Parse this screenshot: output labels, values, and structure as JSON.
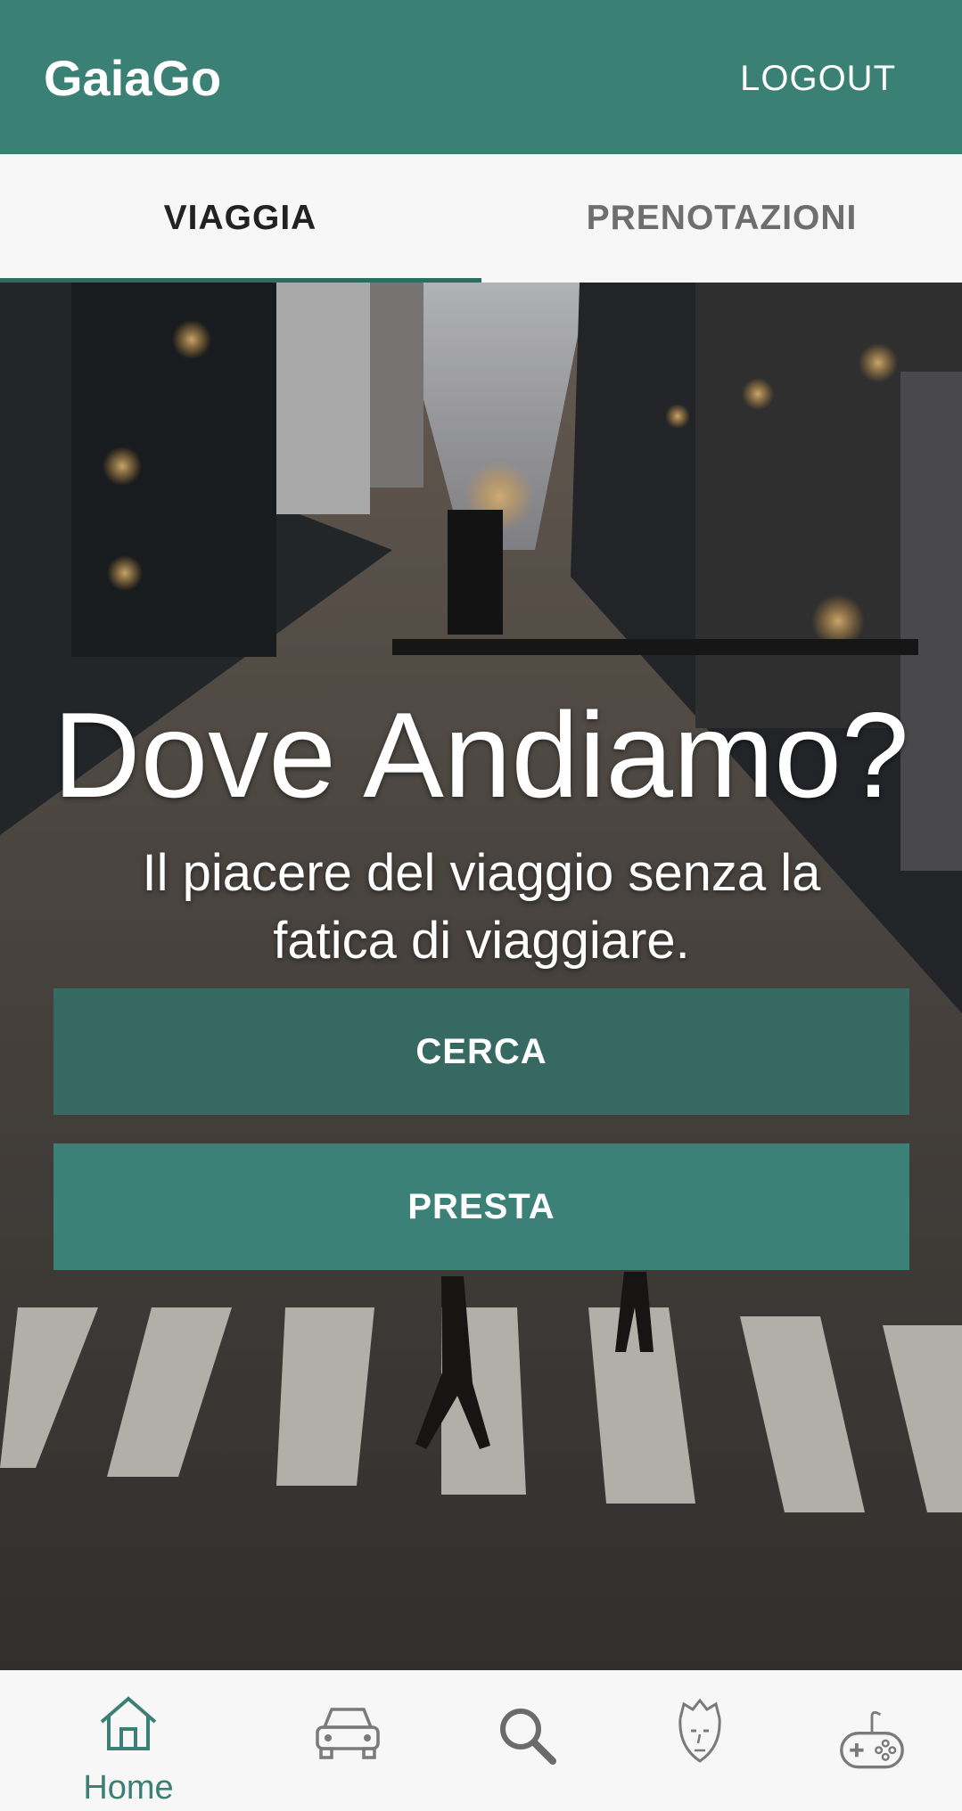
{
  "app": {
    "title": "GaiaGo",
    "logout_label": "LOGOUT",
    "accent_color": "#3a8075"
  },
  "tabs": [
    {
      "label": "VIAGGIA",
      "selected": true
    },
    {
      "label": "PRENOTAZIONI",
      "selected": false
    }
  ],
  "hero": {
    "title": "Dove Andiamo?",
    "subtitle": "Il piacere del viaggio senza la fatica di viaggiare.",
    "background": "rainy-city-street-photo"
  },
  "buttons": {
    "cerca_label": "CERCA",
    "presta_label": "PRESTA"
  },
  "bottom_nav": [
    {
      "icon": "home-icon",
      "label": "Home",
      "selected": true
    },
    {
      "icon": "car-icon",
      "label": "",
      "selected": false
    },
    {
      "icon": "search-icon",
      "label": "",
      "selected": false
    },
    {
      "icon": "profile-face-icon",
      "label": "",
      "selected": false
    },
    {
      "icon": "gamepad-icon",
      "label": "",
      "selected": false
    }
  ]
}
